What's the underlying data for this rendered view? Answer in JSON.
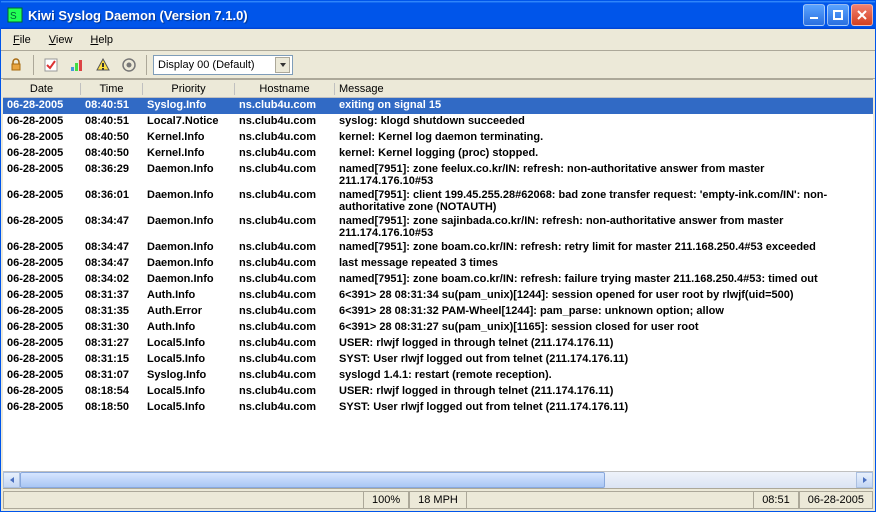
{
  "titlebar": {
    "title": "Kiwi Syslog Daemon (Version 7.1.0)"
  },
  "menubar": {
    "file": "File",
    "view": "View",
    "help": "Help"
  },
  "toolbar": {
    "display_selected": "Display 00 (Default)"
  },
  "columns": {
    "date": "Date",
    "time": "Time",
    "priority": "Priority",
    "hostname": "Hostname",
    "message": "Message"
  },
  "rows": [
    {
      "date": "06-28-2005",
      "time": "08:40:51",
      "priority": "Syslog.Info",
      "hostname": "ns.club4u.com",
      "message": "exiting on signal 15",
      "selected": true
    },
    {
      "date": "06-28-2005",
      "time": "08:40:51",
      "priority": "Local7.Notice",
      "hostname": "ns.club4u.com",
      "message": "syslog: klogd shutdown succeeded"
    },
    {
      "date": "06-28-2005",
      "time": "08:40:50",
      "priority": "Kernel.Info",
      "hostname": "ns.club4u.com",
      "message": "kernel: Kernel log daemon terminating."
    },
    {
      "date": "06-28-2005",
      "time": "08:40:50",
      "priority": "Kernel.Info",
      "hostname": "ns.club4u.com",
      "message": "kernel: Kernel logging (proc) stopped."
    },
    {
      "date": "06-28-2005",
      "time": "08:36:29",
      "priority": "Daemon.Info",
      "hostname": "ns.club4u.com",
      "message": "named[7951]: zone feelux.co.kr/IN: refresh: non-authoritative answer from master 211.174.176.10#53"
    },
    {
      "date": "06-28-2005",
      "time": "08:36:01",
      "priority": "Daemon.Info",
      "hostname": "ns.club4u.com",
      "message": "named[7951]: client 199.45.255.28#62068: bad zone transfer request: 'empty-ink.com/IN': non-authoritative zone (NOTAUTH)"
    },
    {
      "date": "06-28-2005",
      "time": "08:34:47",
      "priority": "Daemon.Info",
      "hostname": "ns.club4u.com",
      "message": "named[7951]: zone sajinbada.co.kr/IN: refresh: non-authoritative answer from master 211.174.176.10#53"
    },
    {
      "date": "06-28-2005",
      "time": "08:34:47",
      "priority": "Daemon.Info",
      "hostname": "ns.club4u.com",
      "message": "named[7951]: zone boam.co.kr/IN: refresh: retry limit for master 211.168.250.4#53 exceeded"
    },
    {
      "date": "06-28-2005",
      "time": "08:34:47",
      "priority": "Daemon.Info",
      "hostname": "ns.club4u.com",
      "message": "last message repeated 3 times"
    },
    {
      "date": "06-28-2005",
      "time": "08:34:02",
      "priority": "Daemon.Info",
      "hostname": "ns.club4u.com",
      "message": "named[7951]: zone boam.co.kr/IN: refresh: failure trying master 211.168.250.4#53: timed out"
    },
    {
      "date": "06-28-2005",
      "time": "08:31:37",
      "priority": "Auth.Info",
      "hostname": "ns.club4u.com",
      "message": "6<391> 28 08:31:34 su(pam_unix)[1244]: session opened for user root by rlwjf(uid=500)"
    },
    {
      "date": "06-28-2005",
      "time": "08:31:35",
      "priority": "Auth.Error",
      "hostname": "ns.club4u.com",
      "message": "6<391> 28 08:31:32 PAM-Wheel[1244]: pam_parse: unknown option; allow"
    },
    {
      "date": "06-28-2005",
      "time": "08:31:30",
      "priority": "Auth.Info",
      "hostname": "ns.club4u.com",
      "message": "6<391> 28 08:31:27 su(pam_unix)[1165]: session closed for user root"
    },
    {
      "date": "06-28-2005",
      "time": "08:31:27",
      "priority": "Local5.Info",
      "hostname": "ns.club4u.com",
      "message": "USER: rlwjf logged in through telnet (211.174.176.11)"
    },
    {
      "date": "06-28-2005",
      "time": "08:31:15",
      "priority": "Local5.Info",
      "hostname": "ns.club4u.com",
      "message": "SYST: User rlwjf logged out from telnet (211.174.176.11)"
    },
    {
      "date": "06-28-2005",
      "time": "08:31:07",
      "priority": "Syslog.Info",
      "hostname": "ns.club4u.com",
      "message": "syslogd 1.4.1: restart (remote reception)."
    },
    {
      "date": "06-28-2005",
      "time": "08:18:54",
      "priority": "Local5.Info",
      "hostname": "ns.club4u.com",
      "message": "USER: rlwjf logged in through telnet (211.174.176.11)"
    },
    {
      "date": "06-28-2005",
      "time": "08:18:50",
      "priority": "Local5.Info",
      "hostname": "ns.club4u.com",
      "message": "SYST: User rlwjf logged out from telnet (211.174.176.11)"
    }
  ],
  "status": {
    "percent": "100%",
    "speed": "18 MPH",
    "clock": "08:51",
    "date": "06-28-2005"
  }
}
